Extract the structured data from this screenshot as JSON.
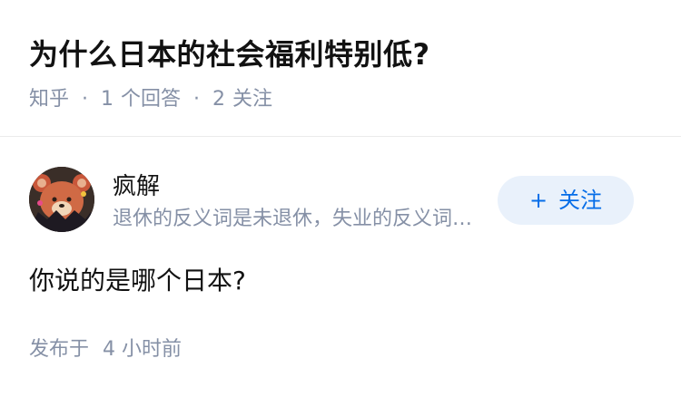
{
  "question": {
    "title": "为什么日本的社会福利特别低?",
    "source": "知乎",
    "answer_count": "1",
    "answer_label": "个回答",
    "follower_count": "2",
    "follower_label": "关注"
  },
  "author": {
    "name": "疯解",
    "bio": "退休的反义词是未退休，失业的反义词是未失业",
    "follow_label": "关注",
    "follow_icon": "plus-icon"
  },
  "answer": {
    "content": "你说的是哪个日本?",
    "published_label": "发布于",
    "published_time": "4 小时前"
  },
  "colors": {
    "accent": "#056de8",
    "button_bg": "#e9f1fb",
    "meta_text": "#8590a6",
    "title_text": "#121212"
  }
}
